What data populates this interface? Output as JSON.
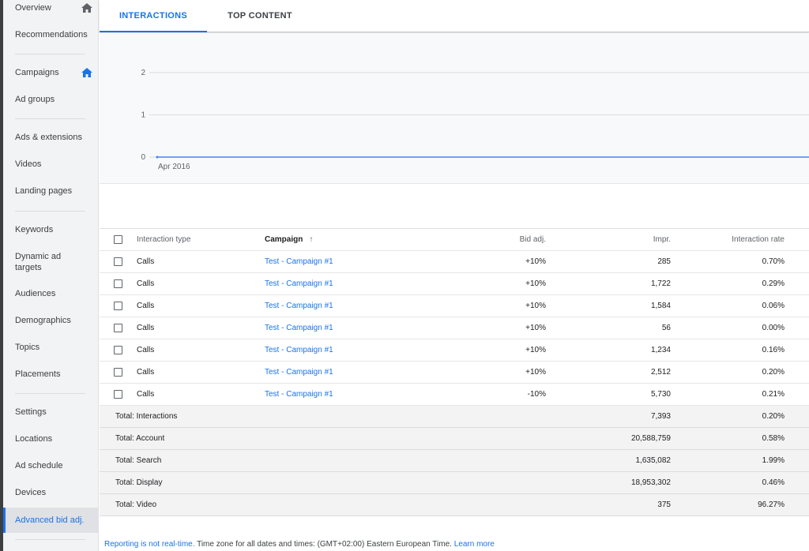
{
  "sidebar": {
    "items": [
      {
        "label": "Overview",
        "icon": "home-icon"
      },
      {
        "label": "Recommendations"
      },
      {
        "label": "Campaigns",
        "icon": "home-icon"
      },
      {
        "label": "Ad groups"
      },
      {
        "label": "Ads & extensions"
      },
      {
        "label": "Videos"
      },
      {
        "label": "Landing pages"
      },
      {
        "label": "Keywords"
      },
      {
        "label": "Dynamic ad targets"
      },
      {
        "label": "Audiences"
      },
      {
        "label": "Demographics"
      },
      {
        "label": "Topics"
      },
      {
        "label": "Placements"
      },
      {
        "label": "Settings"
      },
      {
        "label": "Locations"
      },
      {
        "label": "Ad schedule"
      },
      {
        "label": "Devices"
      },
      {
        "label": "Advanced bid adj.",
        "active": true
      }
    ]
  },
  "tabs": [
    {
      "label": "INTERACTIONS",
      "active": true
    },
    {
      "label": "TOP CONTENT"
    }
  ],
  "chart_data": {
    "type": "line",
    "x": [
      "Apr 2016"
    ],
    "x_tick_labels": [
      "Apr 2016"
    ],
    "y_ticks": [
      0,
      1,
      2
    ],
    "ylim": [
      0,
      2
    ],
    "series": [
      {
        "values": [
          0
        ],
        "color": "#4285f4"
      }
    ],
    "grid": true
  },
  "table": {
    "headers": {
      "interaction_type": "Interaction type",
      "campaign": "Campaign",
      "bid_adj": "Bid adj.",
      "impr": "Impr.",
      "interaction_rate": "Interaction rate",
      "sort_icon": "arrow-up-icon"
    },
    "rows": [
      {
        "type": "Calls",
        "campaign": "Test - Campaign #1",
        "bid": "+10%",
        "impr": "285",
        "rate": "0.70%"
      },
      {
        "type": "Calls",
        "campaign": "Test - Campaign #1",
        "bid": "+10%",
        "impr": "1,722",
        "rate": "0.29%"
      },
      {
        "type": "Calls",
        "campaign": "Test - Campaign #1",
        "bid": "+10%",
        "impr": "1,584",
        "rate": "0.06%"
      },
      {
        "type": "Calls",
        "campaign": "Test - Campaign #1",
        "bid": "+10%",
        "impr": "56",
        "rate": "0.00%"
      },
      {
        "type": "Calls",
        "campaign": "Test - Campaign #1",
        "bid": "+10%",
        "impr": "1,234",
        "rate": "0.16%"
      },
      {
        "type": "Calls",
        "campaign": "Test - Campaign #1",
        "bid": "+10%",
        "impr": "2,512",
        "rate": "0.20%"
      },
      {
        "type": "Calls",
        "campaign": "Test - Campaign #1",
        "bid": "-10%",
        "impr": "5,730",
        "rate": "0.21%"
      }
    ],
    "totals": [
      {
        "label": "Total: Interactions",
        "impr": "7,393",
        "rate": "0.20%"
      },
      {
        "label": "Total: Account",
        "impr": "20,588,759",
        "rate": "0.58%"
      },
      {
        "label": "Total: Search",
        "impr": "1,635,082",
        "rate": "1.99%"
      },
      {
        "label": "Total: Display",
        "impr": "18,953,302",
        "rate": "0.46%"
      },
      {
        "label": "Total: Video",
        "impr": "375",
        "rate": "96.27%"
      }
    ]
  },
  "footer": {
    "notice": "Reporting is not real-time.",
    "timezone": " Time zone for all dates and times: (GMT+02:00) Eastern European Time. ",
    "learn_more": "Learn more"
  },
  "colors": {
    "accent": "#1a73e8",
    "chart_line": "#4285f4",
    "sidebar_bg": "#f1f3f4"
  }
}
